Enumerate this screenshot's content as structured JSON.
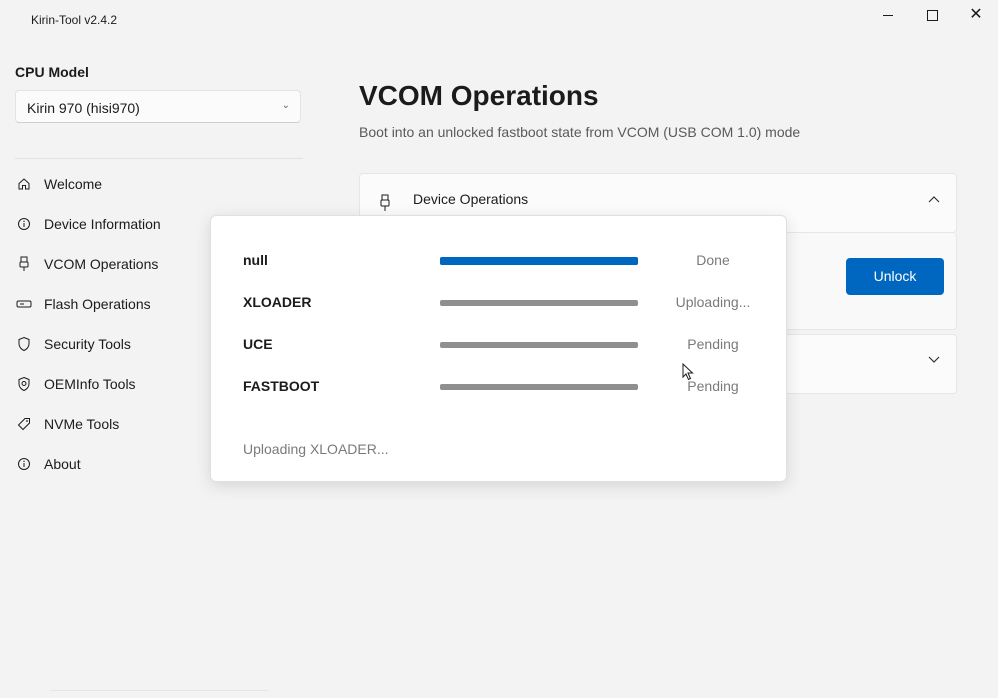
{
  "window": {
    "title": "Kirin-Tool v2.4.2",
    "controls": {
      "minimize": "minimize-icon",
      "maximize": "maximize-icon",
      "close": "close-icon"
    }
  },
  "sidebar": {
    "cpu_label": "CPU Model",
    "cpu_selected": "Kirin 970 (hisi970)",
    "items": [
      {
        "label": "Welcome",
        "icon": "home-icon"
      },
      {
        "label": "Device Information",
        "icon": "info-icon"
      },
      {
        "label": "VCOM Operations",
        "icon": "usb-icon"
      },
      {
        "label": "Flash Operations",
        "icon": "drive-icon"
      },
      {
        "label": "Security Tools",
        "icon": "shield-icon"
      },
      {
        "label": "OEMInfo Tools",
        "icon": "shield-gear-icon"
      },
      {
        "label": "NVMe Tools",
        "icon": "tag-icon"
      },
      {
        "label": "About",
        "icon": "info-icon"
      }
    ]
  },
  "main": {
    "title": "VCOM Operations",
    "subtitle": "Boot into an unlocked fastboot state from VCOM (USB COM 1.0) mode",
    "card1": {
      "title": "Device Operations",
      "icon": "usb-plug-icon",
      "action_label": "Unlock"
    }
  },
  "dialog": {
    "stages": [
      {
        "name": "null",
        "status": "Done",
        "progress": 1.0
      },
      {
        "name": "XLOADER",
        "status": "Uploading...",
        "progress": 0.0
      },
      {
        "name": "UCE",
        "status": "Pending",
        "progress": 0.0
      },
      {
        "name": "FASTBOOT",
        "status": "Pending",
        "progress": 0.0
      }
    ],
    "status_text": "Uploading XLOADER..."
  },
  "colors": {
    "accent": "#0067c0",
    "track": "#8a8a8a",
    "background": "#f3f3f3"
  }
}
